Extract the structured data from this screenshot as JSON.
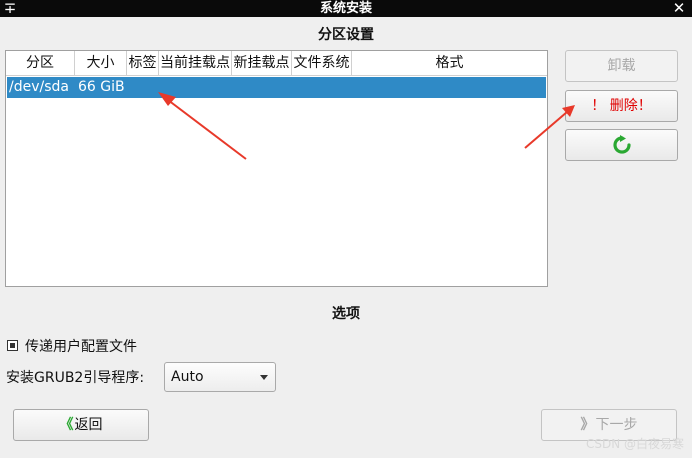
{
  "window": {
    "title": "系统安装",
    "pin_glyph": "∓",
    "close_glyph": "✕"
  },
  "partition_section": {
    "title": "分区设置",
    "columns": [
      "分区",
      "大小",
      "标签",
      "当前挂载点",
      "新挂载点",
      "文件系统",
      "格式"
    ],
    "rows": [
      {
        "partition": "/dev/sda",
        "size": "66 GiB",
        "label": "",
        "current_mount": "",
        "new_mount": "",
        "filesystem": "",
        "format": ""
      }
    ]
  },
  "side_buttons": {
    "unmount_label": "卸载",
    "delete_label": "！ 删除！",
    "refresh_icon": "refresh-icon"
  },
  "options_section": {
    "title": "选项",
    "pass_config_label": "传递用户配置文件",
    "pass_config_checked": true,
    "grub_label": "安装GRUB2引导程序:",
    "grub_value": "Auto"
  },
  "nav": {
    "back_icon": "《",
    "back_label": "返回",
    "next_icon": "》",
    "next_label": "下一步"
  },
  "watermark": "CSDN @白夜易寒",
  "colors": {
    "selection": "#2f8ac6",
    "danger": "#e00000",
    "refresh": "#2aa832",
    "back_icon": "#2aa832",
    "annotation": "#e8392a"
  }
}
